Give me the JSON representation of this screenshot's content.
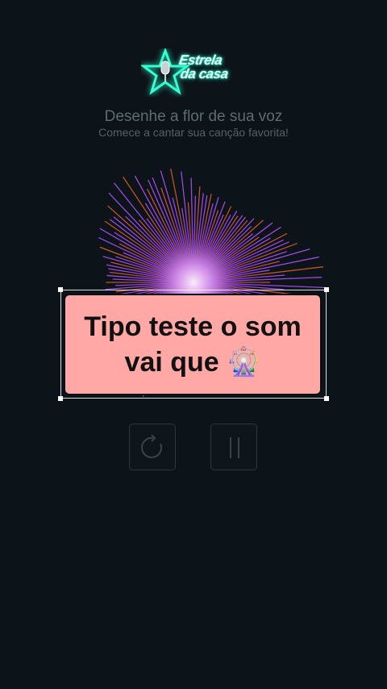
{
  "logo": {
    "line1": "Estrela",
    "line2": "da casa",
    "icon": "microphone-star-icon"
  },
  "header": {
    "title": "Desenhe a flor de sua voz",
    "subtitle": "Comece a cantar sua canção favorita!"
  },
  "caption": {
    "text_line1": "Tipo teste o som",
    "text_line2": "vai que 🎡"
  },
  "controls": {
    "restart_icon": "restart-icon",
    "pause_icon": "pause-icon"
  },
  "colors": {
    "background": "#0c1319",
    "caption_bg": "#ffa8a5",
    "flower_purple": "#b455ff",
    "flower_orange": "#ff6a2a",
    "logo_glow": "#33ffd0"
  }
}
